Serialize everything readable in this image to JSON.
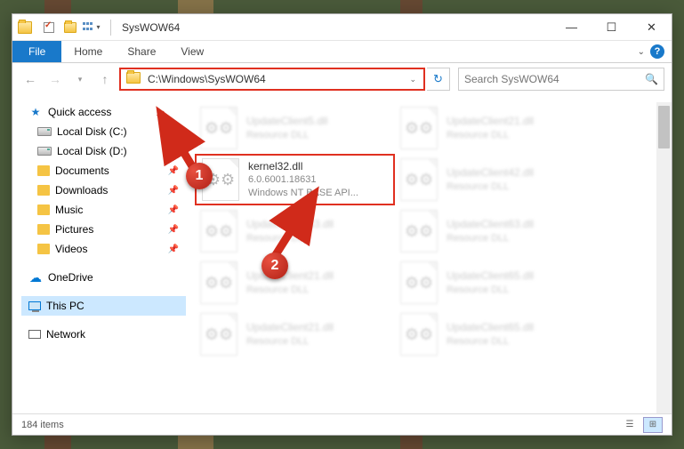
{
  "window": {
    "title": "SysWOW64"
  },
  "ribbon": {
    "file_tab": "File",
    "tabs": [
      "Home",
      "Share",
      "View"
    ]
  },
  "navbar": {
    "address": "C:\\Windows\\SysWOW64",
    "search_placeholder": "Search SysWOW64"
  },
  "sidebar": {
    "quick_access": "Quick access",
    "items": [
      {
        "label": "Local Disk (C:)",
        "icon": "drive",
        "pinned": true
      },
      {
        "label": "Local Disk (D:)",
        "icon": "drive",
        "pinned": true
      },
      {
        "label": "Documents",
        "icon": "folder",
        "pinned": true
      },
      {
        "label": "Downloads",
        "icon": "folder",
        "pinned": true
      },
      {
        "label": "Music",
        "icon": "folder",
        "pinned": true
      },
      {
        "label": "Pictures",
        "icon": "folder",
        "pinned": true
      },
      {
        "label": "Videos",
        "icon": "folder",
        "pinned": true
      }
    ],
    "onedrive": "OneDrive",
    "this_pc": "This PC",
    "network": "Network"
  },
  "files": {
    "highlighted": {
      "name": "kernel32.dll",
      "version": "6.0.6001.18631",
      "desc": "Windows NT BASE API..."
    },
    "bg": [
      {
        "name": "UpdateClient5.dll",
        "desc": "Resource DLL"
      },
      {
        "name": "UpdateClient21.dll",
        "desc": "Resource DLL"
      },
      {
        "name": "UpdateClient42.dll",
        "desc": "Resource DLL"
      },
      {
        "name": "UpdateClient63.dll",
        "desc": "Resource DLL"
      },
      {
        "name": "UpdateClient63.dll",
        "desc": "Resource DLL"
      },
      {
        "name": "UpdateClient21.dll",
        "desc": "Resource DLL"
      },
      {
        "name": "UpdateClient65.dll",
        "desc": "Resource DLL"
      },
      {
        "name": "UpdateClient21.dll",
        "desc": "Resource DLL"
      },
      {
        "name": "UpdateClient65.dll",
        "desc": "Resource DLL"
      }
    ]
  },
  "status": {
    "count": "184 items"
  },
  "annotations": {
    "one": "1",
    "two": "2"
  }
}
